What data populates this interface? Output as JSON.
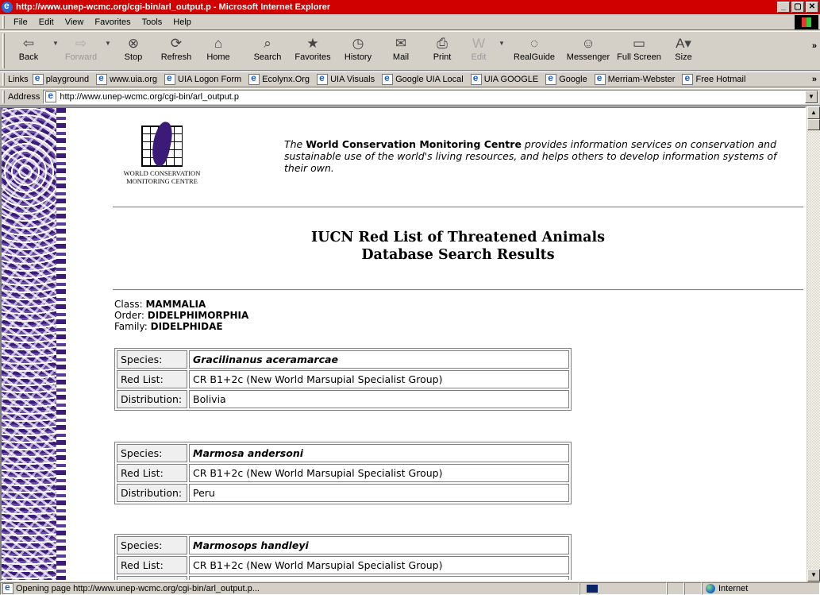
{
  "window": {
    "title": "http://www.unep-wcmc.org/cgi-bin/arl_output.p - Microsoft Internet Explorer",
    "controls": [
      "_",
      "▢",
      "✕"
    ]
  },
  "menu": [
    "File",
    "Edit",
    "View",
    "Favorites",
    "Tools",
    "Help"
  ],
  "toolbar": {
    "back": "Back",
    "forward": "Forward",
    "stop": "Stop",
    "refresh": "Refresh",
    "home": "Home",
    "search": "Search",
    "favorites": "Favorites",
    "history": "History",
    "mail": "Mail",
    "print": "Print",
    "edit": "Edit",
    "realguide": "RealGuide",
    "messenger": "Messenger",
    "fullscreen": "Full Screen",
    "size": "Size"
  },
  "links": {
    "label": "Links",
    "items": [
      "playground",
      "www.uia.org",
      "UIA Logon Form",
      "Ecolynx.Org",
      "UIA Visuals",
      "Google UIA Local",
      "UIA GOOGLE",
      "Google",
      "Merriam-Webster",
      "Free Hotmail"
    ]
  },
  "address": {
    "label": "Address",
    "url": "http://www.unep-wcmc.org/cgi-bin/arl_output.p"
  },
  "page": {
    "logo_line1": "WORLD CONSERVATION",
    "logo_line2": "MONITORING CENTRE",
    "intro_pre": "The ",
    "intro_org": "World Conservation Monitoring Centre",
    "intro_post": " provides information services on conservation and sustainable use of the world's living resources, and helps others to develop information systems of their own.",
    "heading_line1": "IUCN Red List of Threatened Animals",
    "heading_line2": "Database Search Results",
    "class_label": "Class: ",
    "class_value": "MAMMALIA",
    "order_label": "Order: ",
    "order_value": "DIDELPHIMORPHIA",
    "family_label": "Family: ",
    "family_value": "DIDELPHIDAE",
    "labels": {
      "species": "Species:",
      "redlist": "Red List:",
      "distribution": "Distribution:"
    },
    "records": [
      {
        "species": "Gracilinanus aceramarcae",
        "redlist": "CR B1+2c (New World Marsupial Specialist Group)",
        "distribution": "Bolivia"
      },
      {
        "species": "Marmosa andersoni",
        "redlist": "CR B1+2c (New World Marsupial Specialist Group)",
        "distribution": "Peru"
      },
      {
        "species": "Marmosops handleyi",
        "redlist": "CR B1+2c (New World Marsupial Specialist Group)",
        "distribution": ""
      }
    ]
  },
  "status": {
    "message": "Opening page http://www.unep-wcmc.org/cgi-bin/arl_output.p...",
    "zone": "Internet"
  }
}
